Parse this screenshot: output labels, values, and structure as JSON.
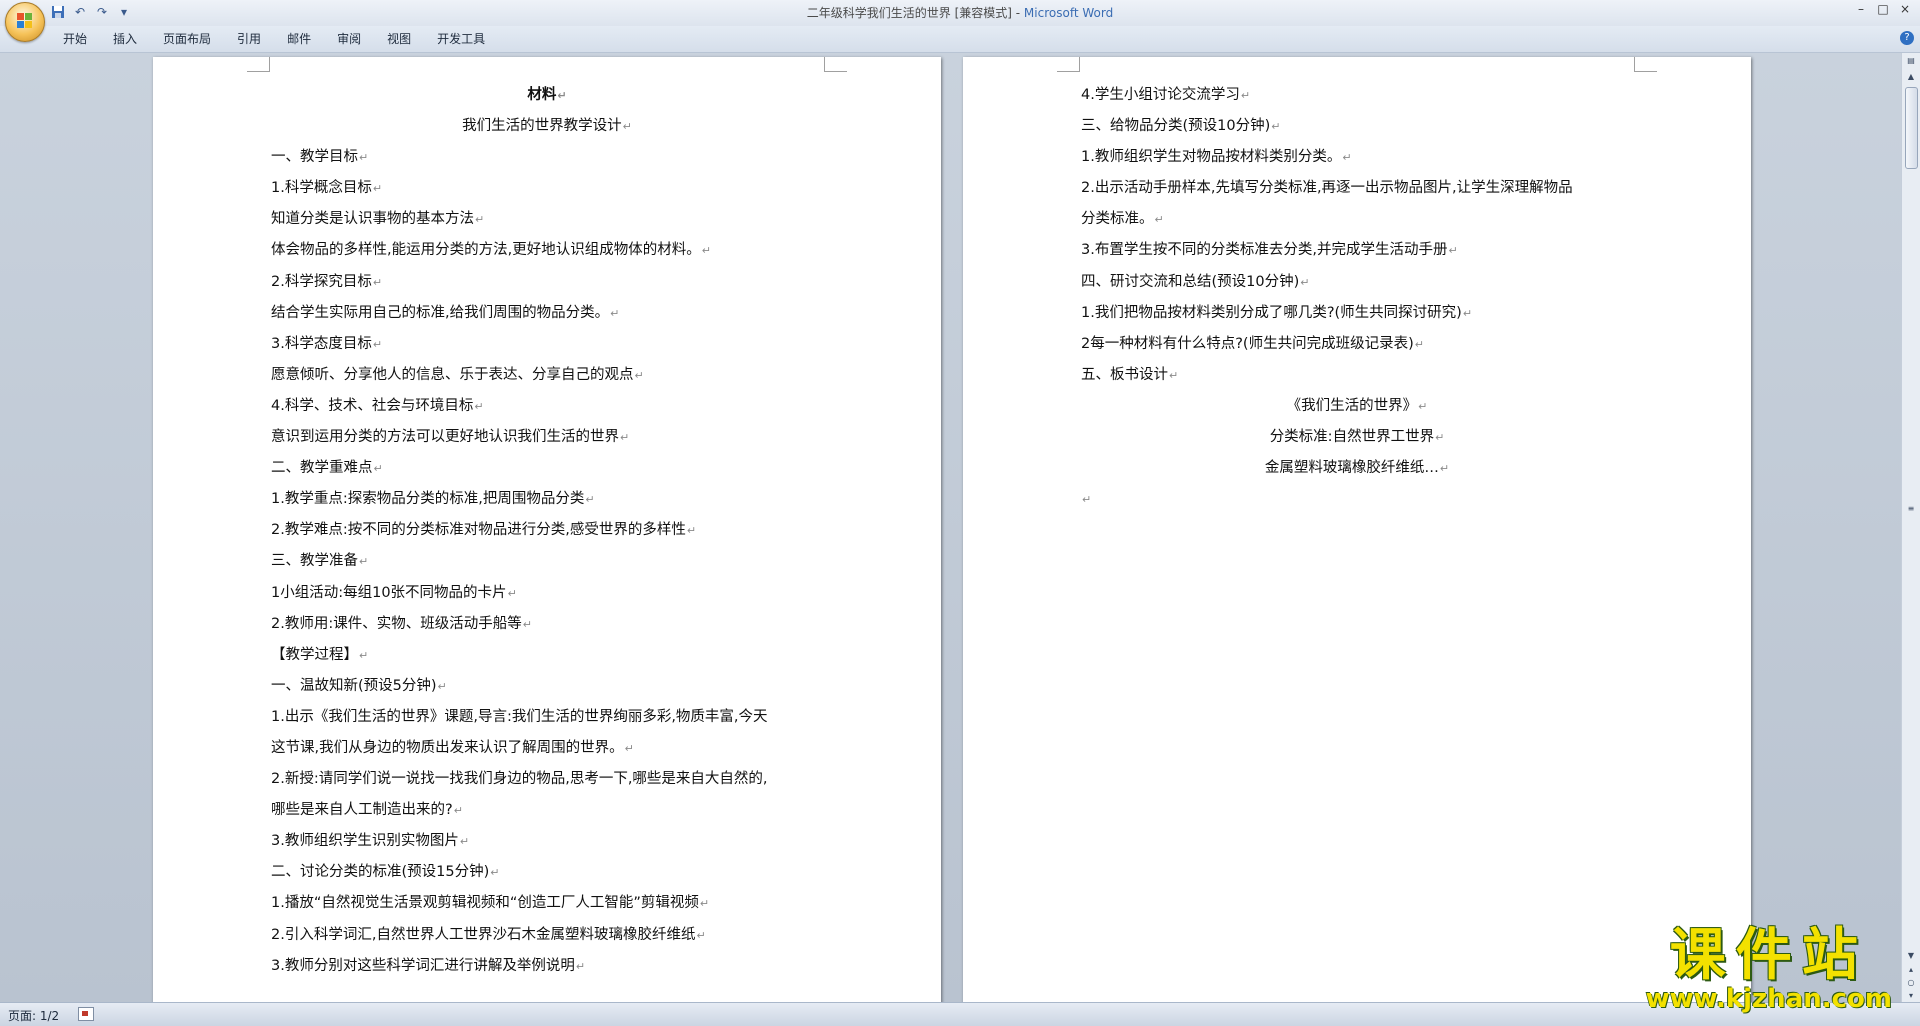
{
  "window": {
    "title_doc": "二年级科学我们生活的世界 [兼容模式] - ",
    "title_app": "Microsoft Word",
    "controls": [
      "–",
      "□",
      "×"
    ]
  },
  "qat": {
    "save_icon": "save-icon",
    "undo_glyph": "↶",
    "redo_glyph": "↷",
    "more_glyph": "▾"
  },
  "ribbon": {
    "tabs": [
      "开始",
      "插入",
      "页面布局",
      "引用",
      "邮件",
      "审阅",
      "视图",
      "开发工具"
    ],
    "help_glyph": "?"
  },
  "page1": {
    "lines": [
      "材料",
      "我们生活的世界教学设计",
      "一、教学目标",
      "1.科学概念目标",
      "知道分类是认识事物的基本方法",
      "体会物品的多样性,能运用分类的方法,更好地认识组成物体的材料。",
      "2.科学探究目标",
      "结合学生实际用自己的标准,给我们周围的物品分类。",
      "3.科学态度目标",
      "愿意倾听、分享他人的信息、乐于表达、分享自己的观点",
      "4.科学、技术、社会与环境目标",
      "意识到运用分类的方法可以更好地认识我们生活的世界",
      "二、教学重难点",
      "1.教学重点:探索物品分类的标准,把周围物品分类",
      "2.教学难点:按不同的分类标准对物品进行分类,感受世界的多样性",
      "三、教学准备",
      "1小组活动:每组10张不同物品的卡片",
      "2.教师用:课件、实物、班级活动手船等",
      "【教学过程】",
      "一、温故知新(预设5分钟)",
      "1.出示《我们生活的世界》课题,导言:我们生活的世界绚丽多彩,物质丰富,今天",
      "这节课,我们从身边的物质出发来认识了解周围的世界。",
      "2.新授:请同学们说一说找一找我们身边的物品,思考一下,哪些是来自大自然的,",
      "哪些是来自人工制造出来的?",
      "3.教师组织学生识别实物图片",
      "二、讨论分类的标准(预设15分钟)",
      "1.播放“自然视觉生活景观剪辑视频和“创造工厂人工智能”剪辑视频",
      "2.引入科学词汇,自然世界人工世界沙石木金属塑料玻璃橡胶纤维纸",
      "3.教师分别对这些科学词汇进行讲解及举例说明"
    ]
  },
  "page2": {
    "lines": [
      "4.学生小组讨论交流学习",
      "三、给物品分类(预设10分钟)",
      "1.教师组织学生对物品按材料类别分类。",
      "2.出示活动手册样本,先填写分类标准,再逐一出示物品图片,让学生深理解物品",
      "分类标准。",
      "3.布置学生按不同的分类标准去分类,并完成学生活动手册",
      "四、研讨交流和总结(预设10分钟)",
      "1.我们把物品按材料类别分成了哪几类?(师生共同探讨研究)",
      "2每一种材料有什么特点?(师生共问完成班级记录表)",
      "五、板书设计",
      "《我们生活的世界》",
      "分类标准:自然世界工世界",
      "金属塑料玻璃橡胶纤维纸…",
      ""
    ]
  },
  "pilcrow": "↵",
  "statusbar": {
    "page": "页面: 1/2"
  },
  "watermark": {
    "title": "课件站",
    "url": "www.kjzhan.com"
  }
}
